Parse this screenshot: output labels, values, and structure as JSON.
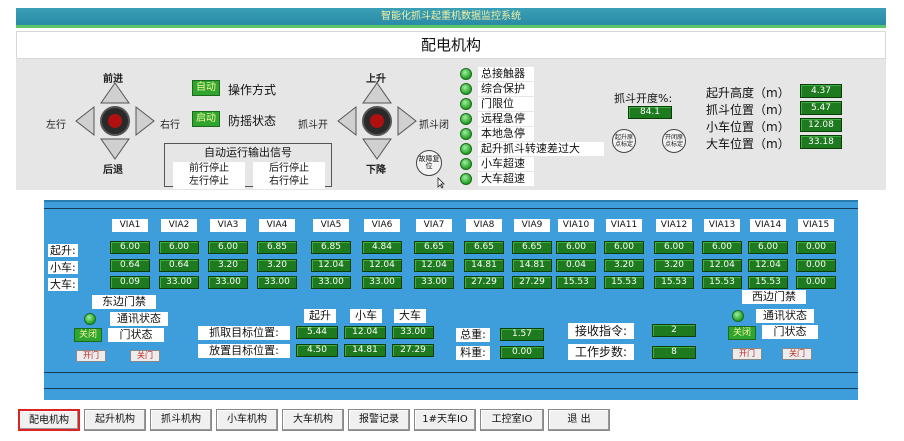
{
  "header": {
    "app_title": "智能化抓斗起重机数据监控系统",
    "page_title": "配电机构"
  },
  "controls": {
    "trolley": {
      "up": "前进",
      "down": "后退",
      "left": "左行",
      "right": "右行",
      "center": "停车"
    },
    "grab": {
      "up": "上升",
      "down": "下降",
      "left": "抓斗开",
      "right": "抓斗闭",
      "center": "停车"
    },
    "operation_mode": {
      "button": "自动",
      "label": "操作方式"
    },
    "anti_sway": {
      "button": "启动",
      "label": "防摇状态"
    },
    "auto_output": {
      "title": "自动运行输出信号",
      "items": [
        "前行停止",
        "后行停止",
        "左行停止",
        "右行停止"
      ]
    },
    "fault_reset": "故障复位"
  },
  "status_items": [
    "总接触器",
    "综合保护",
    "门限位",
    "远程急停",
    "本地急停",
    "起升抓斗转速差过大",
    "小车超速",
    "大车超速"
  ],
  "grab_opening": {
    "label": "抓斗开度%:",
    "value": "84.1"
  },
  "calib_buttons": [
    "起升原点标定",
    "开闭原点标定"
  ],
  "positions": [
    {
      "label": "起升高度（m）",
      "value": "4.37"
    },
    {
      "label": "抓斗位置（m）",
      "value": "5.47"
    },
    {
      "label": "小车位置（m）",
      "value": "12.08"
    },
    {
      "label": "大车位置（m）",
      "value": "33.18"
    }
  ],
  "via_table": {
    "headers": [
      "VIA1",
      "VIA2",
      "VIA3",
      "VIA4",
      "VIA5",
      "VIA6",
      "VIA7",
      "VIA8",
      "VIA9",
      "VIA10",
      "VIA11",
      "VIA12",
      "VIA13",
      "VIA14",
      "VIA15"
    ],
    "rows": [
      {
        "label": "起升:",
        "values": [
          "6.00",
          "6.00",
          "6.00",
          "6.85",
          "6.85",
          "4.84",
          "6.65",
          "6.65",
          "6.65",
          "6.00",
          "6.00",
          "6.00",
          "6.00",
          "6.00",
          "0.00"
        ]
      },
      {
        "label": "小车:",
        "values": [
          "0.64",
          "0.64",
          "3.20",
          "3.20",
          "12.04",
          "12.04",
          "12.04",
          "14.81",
          "14.81",
          "0.04",
          "3.20",
          "3.20",
          "12.04",
          "12.04",
          "0.00"
        ]
      },
      {
        "label": "大车:",
        "values": [
          "0.09",
          "33.00",
          "33.00",
          "33.00",
          "33.00",
          "33.00",
          "33.00",
          "27.29",
          "27.29",
          "15.53",
          "15.53",
          "15.53",
          "15.53",
          "15.53",
          "0.00"
        ]
      }
    ]
  },
  "east_gate": {
    "title": "东边门禁",
    "comm": "通讯状态",
    "state_button": "关闭",
    "state_label": "门状态",
    "open": "开门",
    "close": "关门"
  },
  "west_gate": {
    "title": "西边门禁",
    "comm": "通讯状态",
    "state_button": "关闭",
    "state_label": "门状态",
    "open": "开门",
    "close": "关门"
  },
  "target": {
    "columns": [
      "起升",
      "小车",
      "大车"
    ],
    "grab": {
      "label": "抓取目标位置:",
      "values": [
        "5.44",
        "12.04",
        "33.00"
      ]
    },
    "release": {
      "label": "放置目标位置:",
      "values": [
        "4.50",
        "14.81",
        "27.29"
      ]
    }
  },
  "weights": {
    "total_label": "总重:",
    "total_value": "1.57",
    "material_label": "料重:",
    "material_value": "0.00"
  },
  "commands": {
    "recv_label": "接收指令:",
    "recv_value": "2",
    "step_label": "工作步数:",
    "step_value": "8"
  },
  "nav": [
    "配电机构",
    "起升机构",
    "抓斗机构",
    "小车机构",
    "大车机构",
    "报警记录",
    "1#天车IO",
    "工控室IO",
    "退 出"
  ]
}
